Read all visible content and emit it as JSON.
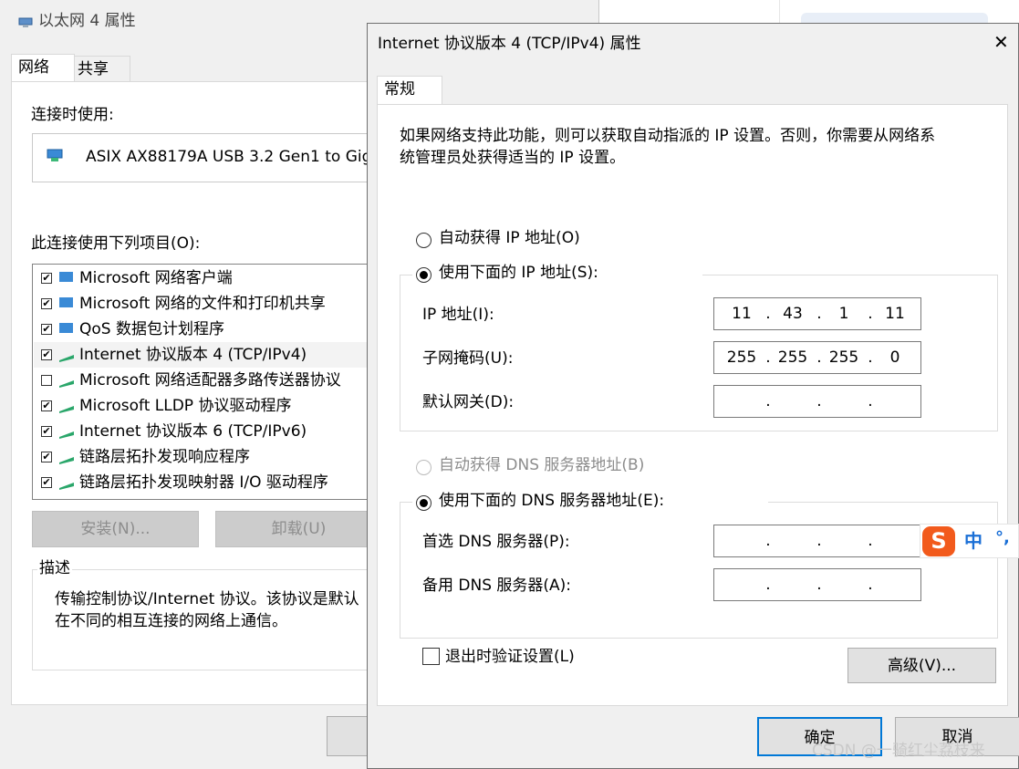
{
  "bg_window": {
    "title": "以太网 4 属性",
    "tabs": [
      "网络",
      "共享"
    ],
    "connect_using_label": "连接时使用:",
    "adapter_name": "ASIX AX88179A USB 3.2 Gen1 to Gig",
    "items_label": "此连接使用下列项目(O):",
    "items": [
      {
        "label": "Microsoft 网络客户端",
        "checked": true
      },
      {
        "label": "Microsoft 网络的文件和打印机共享",
        "checked": true
      },
      {
        "label": "QoS 数据包计划程序",
        "checked": true
      },
      {
        "label": "Internet 协议版本 4 (TCP/IPv4)",
        "checked": true
      },
      {
        "label": "Microsoft 网络适配器多路传送器协议",
        "checked": false
      },
      {
        "label": "Microsoft LLDP 协议驱动程序",
        "checked": true
      },
      {
        "label": "Internet 协议版本 6 (TCP/IPv6)",
        "checked": true
      },
      {
        "label": "链路层拓扑发现响应程序",
        "checked": true
      },
      {
        "label": "链路层拓扑发现映射器 I/O 驱动程序",
        "checked": true
      }
    ],
    "install_button": "安装(N)...",
    "uninstall_button": "卸载(U)",
    "description_label": "描述",
    "description_line1": "传输控制协议/Internet 协议。该协议是默认",
    "description_line2": "在不同的相互连接的网络上通信。"
  },
  "dialog": {
    "title": "Internet 协议版本 4 (TCP/IPv4) 属性",
    "close_glyph": "✕",
    "tab": "常规",
    "intro_line1": "如果网络支持此功能，则可以获取自动指派的 IP 设置。否则，你需要从网络系",
    "intro_line2": "统管理员处获得适当的 IP 设置。",
    "auto_ip_label": "自动获得 IP 地址(O)",
    "manual_ip_label": "使用下面的 IP 地址(S):",
    "ip_label": "IP 地址(I):",
    "ip_value": [
      "11",
      "43",
      "1",
      "11"
    ],
    "mask_label": "子网掩码(U):",
    "mask_value": [
      "255",
      "255",
      "255",
      "0"
    ],
    "gateway_label": "默认网关(D):",
    "gateway_value": [
      "",
      "",
      "",
      ""
    ],
    "auto_dns_label": "自动获得 DNS 服务器地址(B)",
    "manual_dns_label": "使用下面的 DNS 服务器地址(E):",
    "pref_dns_label": "首选 DNS 服务器(P):",
    "pref_dns_value": [
      "",
      "",
      "",
      ""
    ],
    "alt_dns_label": "备用 DNS 服务器(A):",
    "alt_dns_value": [
      "",
      "",
      "",
      ""
    ],
    "validate_label": "退出时验证设置(L)",
    "advanced_button": "高级(V)...",
    "ok_button": "确定",
    "cancel_button": "取消"
  },
  "ime": {
    "logo": "S",
    "mode": "中",
    "punct": "°,"
  },
  "watermark": "CSDN @一骑红尘荔枝来",
  "colors": {
    "accent": "#0078d7",
    "ime_orange": "#f25a1c",
    "ime_blue": "#1a6fd6"
  }
}
